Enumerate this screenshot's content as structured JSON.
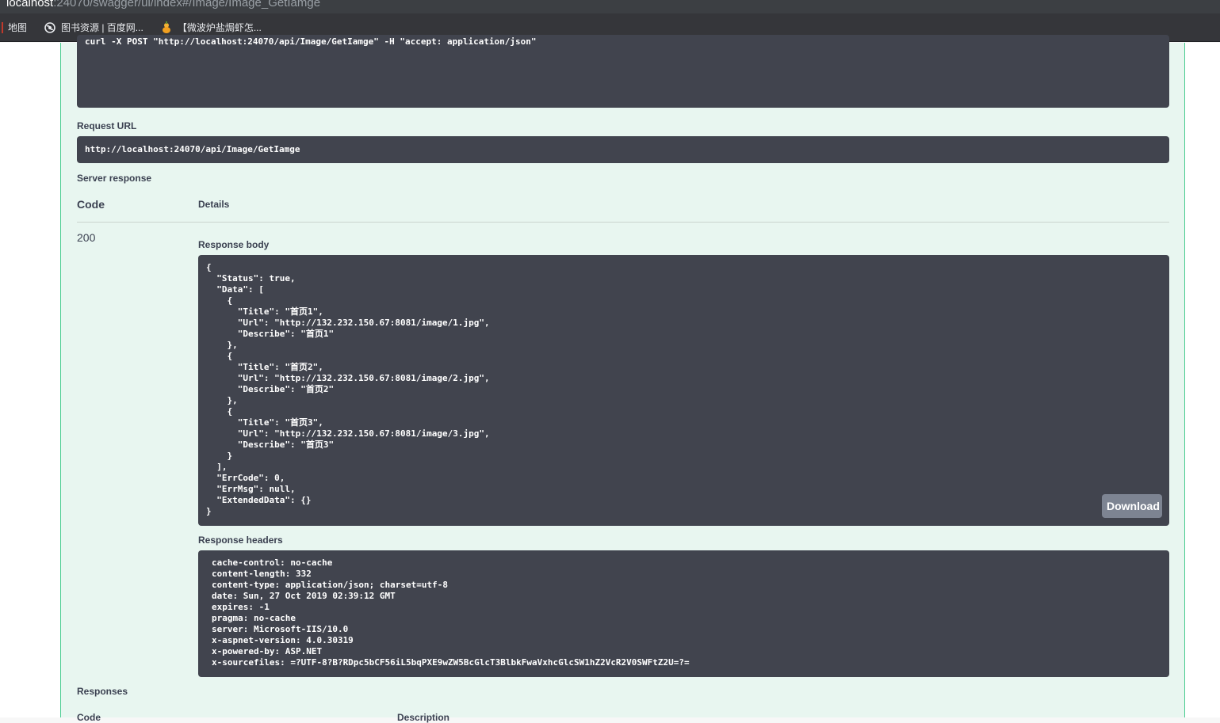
{
  "browser": {
    "address_host": "localhost",
    "address_path": ":24070/swagger/ui/index#/Image/Image_GetIamge",
    "bookmarks": [
      {
        "label": "地图",
        "icon": "separator-icon"
      },
      {
        "label": "图书资源 | 百度网...",
        "icon": "globe-icon"
      },
      {
        "label": "【微波炉盐焗虾怎...",
        "icon": "gourd-icon"
      }
    ]
  },
  "curl": {
    "command": "curl -X POST \"http://localhost:24070/api/Image/GetIamge\" -H \"accept: application/json\""
  },
  "request_url": {
    "label": "Request URL",
    "value": "http://localhost:24070/api/Image/GetIamge"
  },
  "server_response": {
    "label": "Server response",
    "code_header": "Code",
    "details_header": "Details",
    "code": "200",
    "response_body_label": "Response body",
    "response_body": "{\n  \"Status\": true,\n  \"Data\": [\n    {\n      \"Title\": \"首页1\",\n      \"Url\": \"http://132.232.150.67:8081/image/1.jpg\",\n      \"Describe\": \"首页1\"\n    },\n    {\n      \"Title\": \"首页2\",\n      \"Url\": \"http://132.232.150.67:8081/image/2.jpg\",\n      \"Describe\": \"首页2\"\n    },\n    {\n      \"Title\": \"首页3\",\n      \"Url\": \"http://132.232.150.67:8081/image/3.jpg\",\n      \"Describe\": \"首页3\"\n    }\n  ],\n  \"ErrCode\": 0,\n  \"ErrMsg\": null,\n  \"ExtendedData\": {}\n}",
    "download_label": "Download",
    "response_headers_label": "Response headers",
    "response_headers": "cache-control: no-cache\ncontent-length: 332\ncontent-type: application/json; charset=utf-8\ndate: Sun, 27 Oct 2019 02:39:12 GMT\nexpires: -1\npragma: no-cache\nserver: Microsoft-IIS/10.0\nx-aspnet-version: 4.0.30319\nx-powered-by: ASP.NET\nx-sourcefiles: =?UTF-8?B?RDpc5bCF56iL5bqPXE9wZW5BcGlcT3BlbkFwaVxhcGlcSW1hZ2VcR2V0SWFtZ2U=?="
  },
  "responses": {
    "label": "Responses",
    "code_header": "Code",
    "description_header": "Description"
  }
}
